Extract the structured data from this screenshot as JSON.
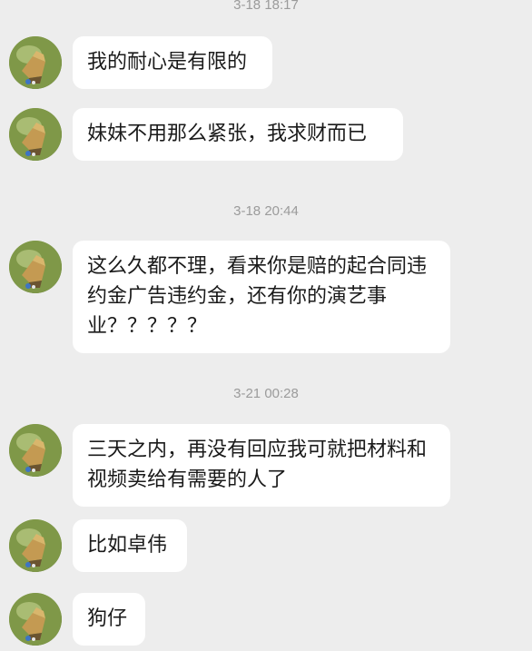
{
  "timestamps": {
    "t0": "3-18 18:17",
    "t1": "3-18 20:44",
    "t2": "3-21 00:28"
  },
  "messages": [
    {
      "text": "我的耐心是有限的"
    },
    {
      "text": "妹妹不用那么紧张，我求财而已"
    },
    {
      "text": "这么久都不理，看来你是赔的起合同违约金广告违约金，还有你的演艺事业？？？？？"
    },
    {
      "text": "三天之内，再没有回应我可就把材料和视频卖给有需要的人了"
    },
    {
      "text": "比如卓伟"
    },
    {
      "text": "狗仔"
    }
  ],
  "avatar": {
    "icon": "game-character-avatar-icon"
  },
  "colors": {
    "background": "#ededed",
    "bubble": "#ffffff",
    "timestamp": "#9b9b9b",
    "text": "#1a1a1a"
  }
}
